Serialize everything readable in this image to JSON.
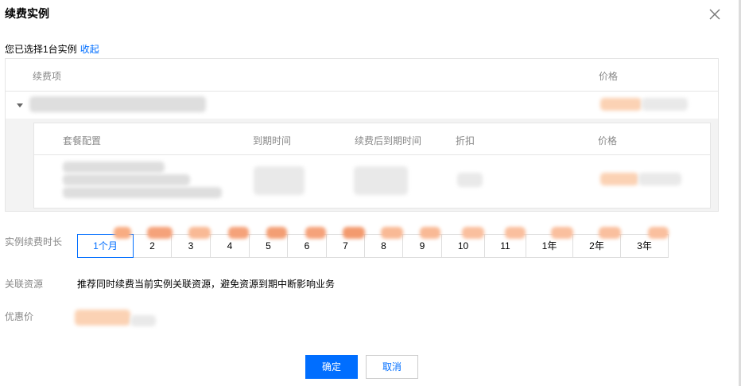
{
  "dialog": {
    "title": "续费实例",
    "selected_text": "您已选择1台实例",
    "collapse_link": "收起"
  },
  "outer_table": {
    "columns": [
      "续费项",
      "价格"
    ]
  },
  "inner_table": {
    "columns": [
      "套餐配置",
      "到期时间",
      "续费后到期时间",
      "折扣",
      "价格"
    ]
  },
  "renewal_duration": {
    "label": "实例续费时长",
    "options": [
      "1个月",
      "2",
      "3",
      "4",
      "5",
      "6",
      "7",
      "8",
      "9",
      "10",
      "11",
      "1年",
      "2年",
      "3年"
    ],
    "selected": "1个月"
  },
  "related_resources": {
    "label": "关联资源",
    "text": "推荐同时续费当前实例关联资源，避免资源到期中断影响业务"
  },
  "discount_price": {
    "label": "优惠价"
  },
  "footer": {
    "confirm_label": "确定",
    "cancel_label": "取消"
  },
  "colors": {
    "accent": "#006eff",
    "promo_tag": "#f8a37a"
  }
}
